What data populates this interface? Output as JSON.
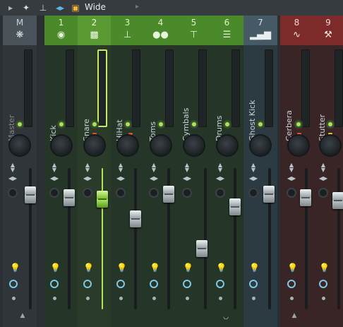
{
  "toolbar": {
    "mode_label": "Wide",
    "icons": [
      "play-arrow-icon",
      "bird-icon",
      "pin-icon",
      "mirror-icon",
      "window-icon",
      "dropdown-arrow-icon"
    ]
  },
  "mixer": {
    "master": {
      "number": "M",
      "name": "Master",
      "icon": "sparkle-icon"
    },
    "inserts": [
      {
        "number": "1",
        "name": "Kick",
        "icon": "kick-drum-icon",
        "group": "drums"
      },
      {
        "number": "2",
        "name": "Snare",
        "icon": "snare-drum-icon",
        "group": "drums",
        "selected": true
      },
      {
        "number": "3",
        "name": "HiHat",
        "icon": "hihat-icon",
        "group": "drums"
      },
      {
        "number": "4",
        "name": "Toms",
        "icon": "toms-icon",
        "group": "drums"
      },
      {
        "number": "5",
        "name": "Cymbals",
        "icon": "cymbal-icon",
        "group": "drums"
      },
      {
        "number": "6",
        "name": "Drums",
        "icon": "drum-bus-icon",
        "group": "drums"
      },
      {
        "number": "7",
        "name": "Ghost Kick",
        "icon": "level-bars-icon",
        "group": "sidechain"
      },
      {
        "number": "8",
        "name": "Cerbera",
        "icon": "synth-wave-icon",
        "group": "synth"
      },
      {
        "number": "9",
        "name": "Stutter",
        "icon": "wrench-icon",
        "group": "synth"
      }
    ]
  },
  "colors": {
    "drums_header": "#4b8a2a",
    "drums_strip": "#253527",
    "sidechain_header": "#465a66",
    "synth_header": "#7c2a2a",
    "led_green": "#a6e55a",
    "fader_green": "#7bc428",
    "clock_blue": "#7ec8e6",
    "lamp_orange": "#f0b23a"
  }
}
